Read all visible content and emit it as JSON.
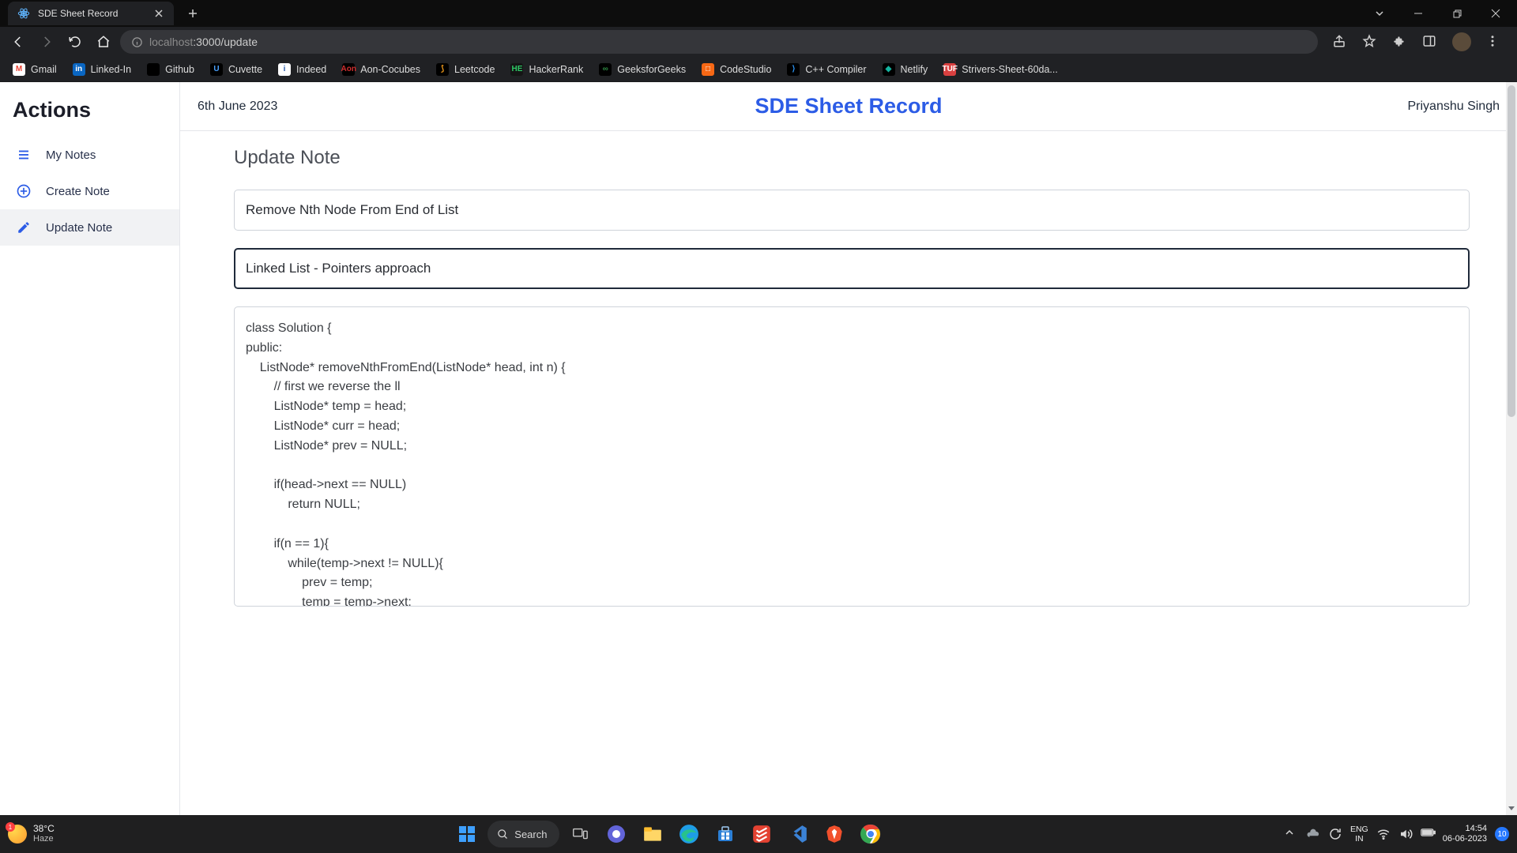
{
  "browser": {
    "tab_title": "SDE Sheet Record",
    "url_host": "localhost",
    "url_port_path": ":3000/update"
  },
  "bookmarks": [
    {
      "label": "Gmail",
      "bg": "#fff",
      "fg": "#ea4335",
      "glyph": "M"
    },
    {
      "label": "Linked-In",
      "bg": "#0a66c2",
      "fg": "#fff",
      "glyph": "in"
    },
    {
      "label": "Github",
      "bg": "#000",
      "fg": "#fff",
      "glyph": ""
    },
    {
      "label": "Cuvette",
      "bg": "#000",
      "fg": "#49a1ff",
      "glyph": "U"
    },
    {
      "label": "Indeed",
      "bg": "#fff",
      "fg": "#2557a7",
      "glyph": "i"
    },
    {
      "label": "Aon-Cocubes",
      "bg": "#000",
      "fg": "#d22f2f",
      "glyph": "Aon"
    },
    {
      "label": "Leetcode",
      "bg": "#000",
      "fg": "#f89f1b",
      "glyph": "⟆"
    },
    {
      "label": "HackerRank",
      "bg": "#151515",
      "fg": "#2ec866",
      "glyph": "HE"
    },
    {
      "label": "GeeksforGeeks",
      "bg": "#000",
      "fg": "#2f8d46",
      "glyph": "∞"
    },
    {
      "label": "CodeStudio",
      "bg": "#f76815",
      "fg": "#fff",
      "glyph": "□"
    },
    {
      "label": "C++ Compiler",
      "bg": "#000",
      "fg": "#2e9bff",
      "glyph": "⟩"
    },
    {
      "label": "Netlify",
      "bg": "#000",
      "fg": "#14b5a0",
      "glyph": "◆"
    },
    {
      "label": "Strivers-Sheet-60da...",
      "bg": "#d94040",
      "fg": "#fff",
      "glyph": "TUF"
    }
  ],
  "sidebar": {
    "title": "Actions",
    "items": [
      {
        "label": "My Notes"
      },
      {
        "label": "Create Note"
      },
      {
        "label": "Update Note"
      }
    ]
  },
  "header": {
    "date": "6th June 2023",
    "app_title": "SDE Sheet Record",
    "user": "Priyanshu Singh"
  },
  "page": {
    "heading": "Update Note",
    "title_value": "Remove Nth Node From End of List",
    "topic_value": "Linked List - Pointers approach",
    "code_value": "class Solution {\npublic:\n    ListNode* removeNthFromEnd(ListNode* head, int n) {\n        // first we reverse the ll\n        ListNode* temp = head;\n        ListNode* curr = head;\n        ListNode* prev = NULL;\n\n        if(head->next == NULL)\n            return NULL;\n\n        if(n == 1){\n            while(temp->next != NULL){\n                prev = temp;\n                temp = temp->next;\n            }\n            prev->next = temp->next;\n            return head;\n        }\n\n        // reverse the ll"
  },
  "taskbar": {
    "temp": "38°C",
    "weather": "Haze",
    "search_placeholder": "Search",
    "lang_top": "ENG",
    "lang_bottom": "IN",
    "time": "14:54",
    "date": "06-06-2023",
    "notif_count": "10"
  }
}
